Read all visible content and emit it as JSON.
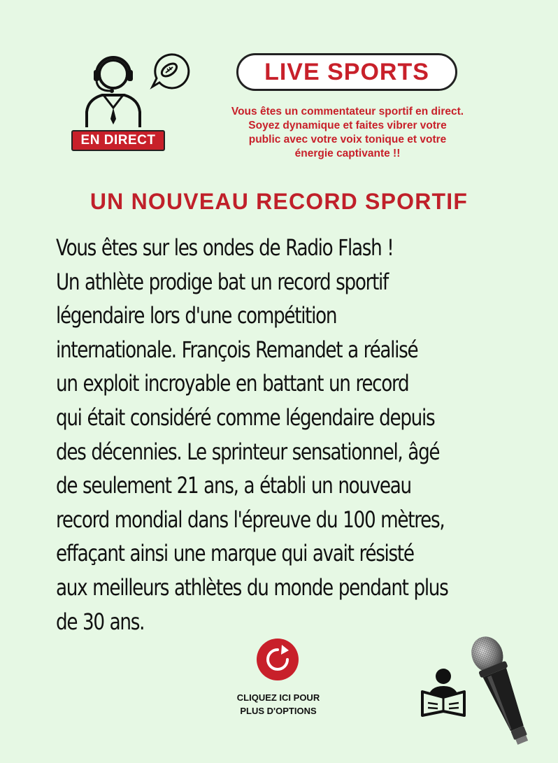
{
  "header": {
    "badge_label": "EN DIRECT",
    "title": "LIVE SPORTS",
    "intro_lines": [
      "Vous êtes un commentateur sportif  en direct.",
      "Soyez dynamique et faites vibrer votre",
      "public avec votre voix tonique et votre",
      "énergie captivante !!"
    ]
  },
  "article": {
    "headline": "UN NOUVEAU RECORD SPORTIF",
    "lines": [
      "Vous êtes sur les ondes de Radio Flash !",
      "Un  athlète prodige bat un record sportif",
      "légendaire lors d'une compétition",
      "internationale. François Remandet a réalisé",
      "un exploit incroyable en battant un record",
      "qui était considéré comme légendaire depuis",
      "des décennies. Le sprinteur sensationnel, âgé",
      "de seulement 21 ans, a établi un nouveau",
      "record mondial dans l'épreuve du 100 mètres,",
      "effaçant ainsi une marque qui avait résisté",
      "aux meilleurs athlètes du monde pendant plus",
      "de 30 ans."
    ]
  },
  "footer": {
    "options_line1": "CLIQUEZ ICI POUR",
    "options_line2": "PLUS D'OPTIONS"
  },
  "colors": {
    "background": "#e6f8e4",
    "accent_red": "#c8202a",
    "text": "#111111"
  },
  "icons": [
    "commentator-headset-icon",
    "football-speech-bubble-icon",
    "refresh-icon",
    "person-reading-icon",
    "microphone-icon"
  ]
}
